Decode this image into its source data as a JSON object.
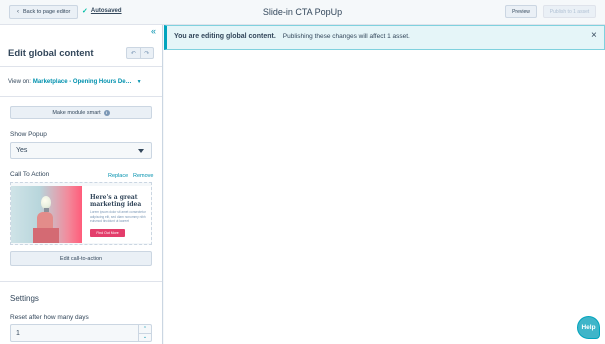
{
  "header": {
    "back_label": "Back to page editor",
    "autosaved_label": "Autosaved",
    "title": "Slide-in CTA PopUp",
    "preview_label": "Preview",
    "publish_label": "Publish to 1 asset"
  },
  "sidebar": {
    "title": "Edit global content",
    "view_on_label": "View on:",
    "view_on_value": "Marketplace - Opening Hours De…",
    "make_smart_label": "Make module smart",
    "show_popup_label": "Show Popup",
    "show_popup_value": "Yes",
    "cta_label": "Call To Action",
    "replace_label": "Replace",
    "remove_label": "Remove",
    "cta_preview": {
      "heading": "Here's a great marketing idea",
      "body": "Lorem ipsum dolor sit amet consectetur adipiscing elit, sed diam nonummy nibh euismod tincidunt ut laoreet",
      "button": "Find Out More"
    },
    "edit_cta_label": "Edit call-to-action",
    "settings_title": "Settings",
    "reset_label": "Reset after how many days",
    "reset_value": "1"
  },
  "banner": {
    "bold_text": "You are editing global content.",
    "text": "Publishing these changes will affect 1 asset."
  },
  "help_label": "Help",
  "colors": {
    "accent": "#0091ae",
    "banner_border": "#00a4bd",
    "cta_button": "#e33d6b"
  }
}
